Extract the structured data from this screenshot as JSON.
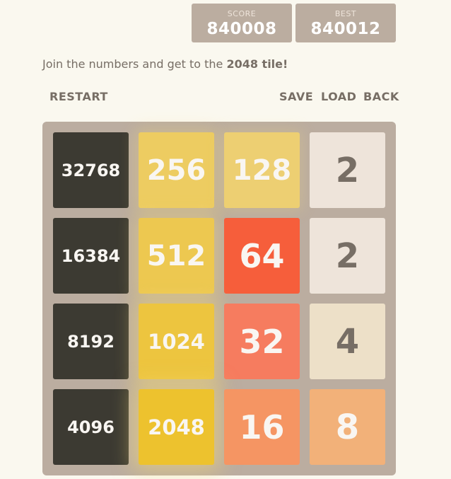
{
  "scores": {
    "score_label": "SCORE",
    "score_value": "840008",
    "best_label": "BEST",
    "best_value": "840012"
  },
  "intro": {
    "text_before": "Join the numbers and get to the ",
    "highlight": "2048 tile!"
  },
  "controls": {
    "restart": "RESTART",
    "save": "SAVE",
    "load": "LOAD",
    "back": "BACK"
  },
  "grid": [
    [
      "32768",
      "256",
      "128",
      "2"
    ],
    [
      "16384",
      "512",
      "64",
      "2"
    ],
    [
      "8192",
      "1024",
      "32",
      "4"
    ],
    [
      "4096",
      "2048",
      "16",
      "8"
    ]
  ],
  "tile_colors": {
    "2": "#eee4da",
    "4": "#ede0c8",
    "8": "#f2b179",
    "16": "#f59563",
    "32": "#f67c5f",
    "64": "#f65e3b",
    "128": "#edcf72",
    "256": "#edcc61",
    "512": "#edc850",
    "1024": "#edc53f",
    "2048": "#edc22e",
    "super": "#3c3a32"
  }
}
